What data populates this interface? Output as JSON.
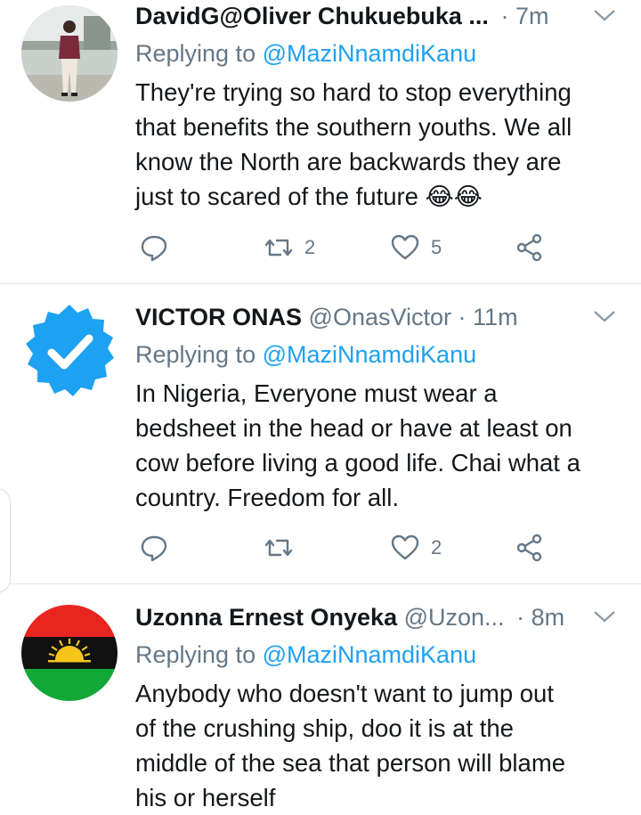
{
  "tweets": [
    {
      "display_name": "DavidG@Oliver Chukuebuka ...",
      "handle": "",
      "time": "· 7m",
      "replying_prefix": "Replying to ",
      "replying_to": "@MaziNnamdiKanu",
      "lines": [
        "They're trying so hard to stop everything",
        "that benefits the southern youths. We all",
        "know the North are backwards they are",
        "just to scared of the future 😂😂"
      ],
      "retweets": "2",
      "likes": "5",
      "avatar": "person-photo"
    },
    {
      "display_name": "VICTOR ONAS",
      "handle": "@OnasVictor",
      "time": "· 11m",
      "replying_prefix": "Replying to ",
      "replying_to": "@MaziNnamdiKanu",
      "lines": [
        "In Nigeria, Everyone must wear a",
        "bedsheet in the head or have at least on",
        "cow before living a good life. Chai what a",
        "country. Freedom for all."
      ],
      "retweets": "",
      "likes": "2",
      "avatar": "verified-badge"
    },
    {
      "display_name": "Uzonna Ernest Onyeka",
      "handle": "@Uzon...",
      "time": "· 8m",
      "replying_prefix": "Replying to ",
      "replying_to": "@MaziNnamdiKanu",
      "lines": [
        "Anybody who doesn't want to jump out",
        "of the crushing ship, doo it is at the",
        "middle of the sea that person will blame",
        "his or herself"
      ],
      "avatar": "biafra-flag"
    }
  ],
  "colors": {
    "accent": "#1da1f2",
    "muted": "#657786",
    "text": "#14171a",
    "divider": "#e1e8ed",
    "flag_red": "#e8251f",
    "flag_black": "#111111",
    "flag_green": "#11a838",
    "flag_sun": "#f5c518"
  }
}
